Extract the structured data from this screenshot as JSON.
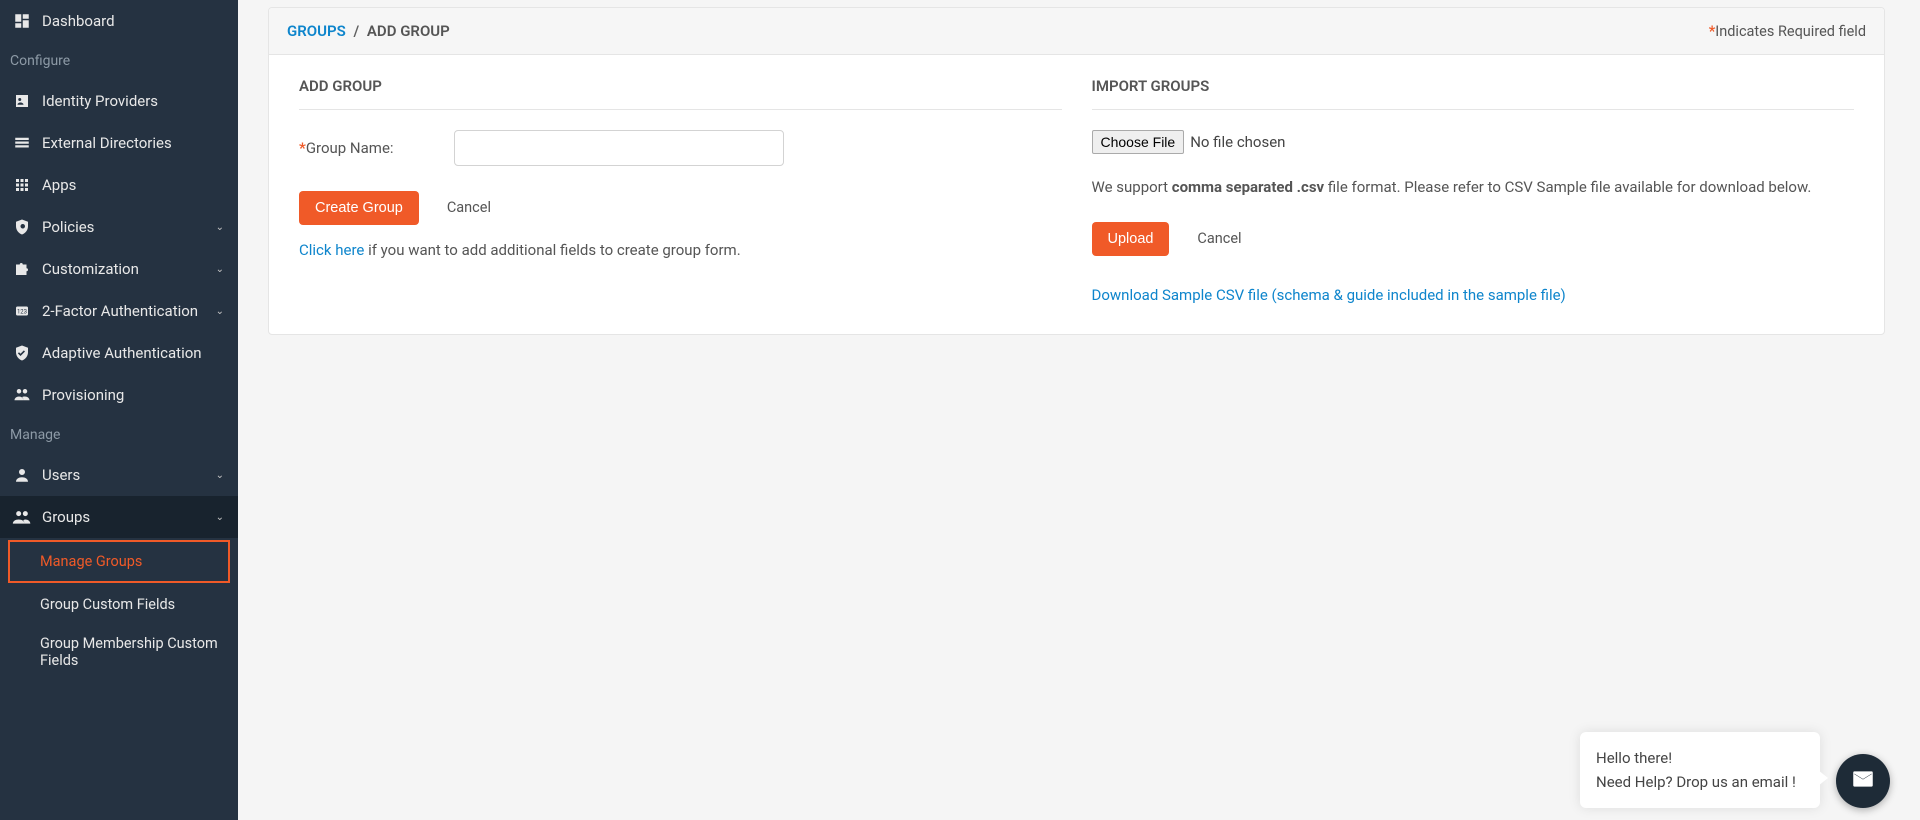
{
  "sidebar": {
    "dashboard": "Dashboard",
    "section_configure": "Configure",
    "identity_providers": "Identity Providers",
    "external_directories": "External Directories",
    "apps": "Apps",
    "policies": "Policies",
    "customization": "Customization",
    "two_factor": "2-Factor Authentication",
    "adaptive_auth": "Adaptive Authentication",
    "provisioning": "Provisioning",
    "section_manage": "Manage",
    "users": "Users",
    "groups": "Groups",
    "sub_manage_groups": "Manage Groups",
    "sub_custom_fields": "Group Custom Fields",
    "sub_membership_fields": "Group Membership Custom Fields"
  },
  "header": {
    "breadcrumb_link": "GROUPS",
    "breadcrumb_sep": "/",
    "breadcrumb_current": "ADD GROUP",
    "star": "*",
    "required": "Indicates Required field"
  },
  "add_group": {
    "title": "ADD GROUP",
    "label": "Group Name:",
    "star": "*",
    "create_btn": "Create Group",
    "cancel": "Cancel",
    "hint_link": "Click here",
    "hint_rest": " if you want to add additional fields to create group form."
  },
  "import": {
    "title": "IMPORT GROUPS",
    "choose_file": "Choose File",
    "no_file": "No file chosen",
    "support_1": "We support ",
    "support_bold": "comma separated .csv",
    "support_2": " file format. Please refer to CSV Sample file available for download below.",
    "upload": "Upload",
    "cancel": "Cancel",
    "download_link": "Download Sample CSV file (schema & guide included in the sample file)"
  },
  "chat": {
    "line1": "Hello there!",
    "line2": "Need Help? Drop us an email !"
  }
}
